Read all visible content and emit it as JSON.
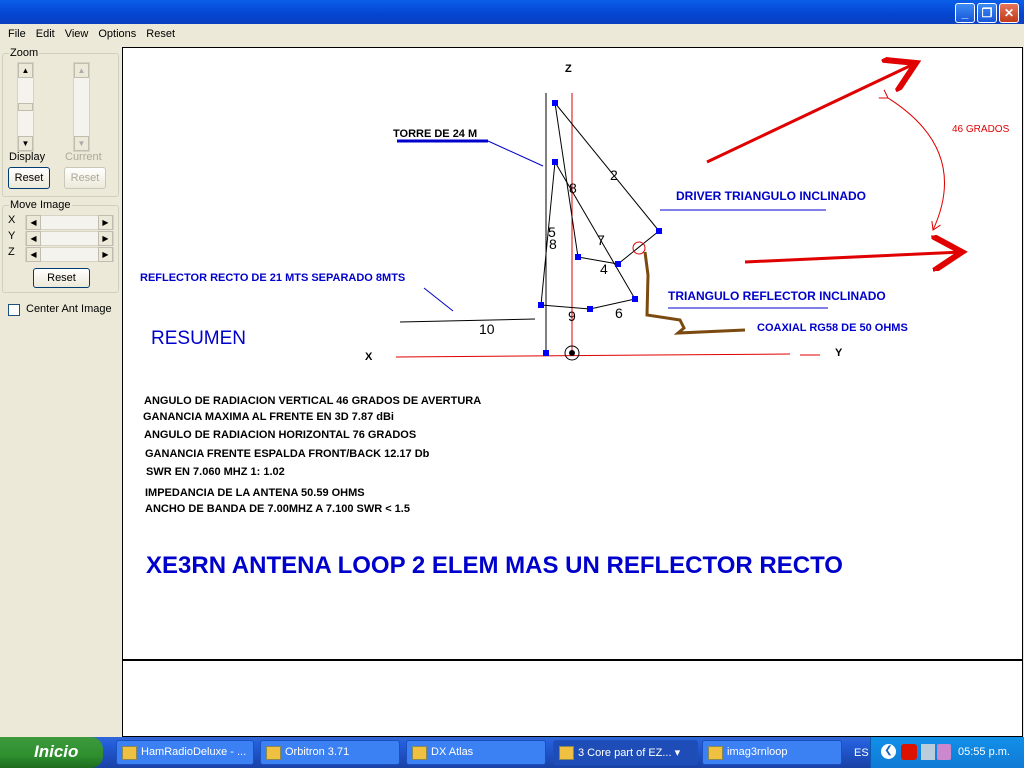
{
  "window": {
    "title": "",
    "controls": [
      "minimize",
      "maximize",
      "close"
    ]
  },
  "menu": [
    "File",
    "Edit",
    "View",
    "Options",
    "Reset"
  ],
  "sidebar": {
    "zoom": {
      "label": "Zoom",
      "display_label": "Display",
      "current_label": "Current",
      "reset": "Reset",
      "reset_disabled": "Reset"
    },
    "move": {
      "label": "Move Image",
      "axes": [
        "X",
        "Y",
        "Z"
      ],
      "reset": "Reset"
    },
    "center_checkbox": {
      "label": "Center Ant Image",
      "checked": false
    }
  },
  "diagram": {
    "axis_z": "Z",
    "axis_x": "X",
    "axis_y": "Y",
    "wire_labels": [
      "2",
      "8",
      "5",
      "8",
      "7",
      "4",
      "9",
      "6",
      "10"
    ],
    "torre": "TORRE DE 24 M",
    "driver": "DRIVER TRIANGULO INCLINADO",
    "reflector_tri": "TRIANGULO REFLECTOR  INCLINADO",
    "reflector_recto": "REFLECTOR RECTO DE 21 MTS SEPARADO 8MTS",
    "coax": "COAXIAL RG58  DE 50 OHMS",
    "grados": "46 GRADOS",
    "resumen": "RESUMEN",
    "summary": [
      "ANGULO DE RADIACION VERTICAL 46 GRADOS DE AVERTURA",
      "GANANCIA MAXIMA AL FRENTE EN 3D   7.87 dBi",
      "ANGULO DE RADIACION HORIZONTAL 76 GRADOS",
      "GANANCIA FRENTE ESPALDA FRONT/BACK 12.17 Db",
      "SWR   EN 7.060 MHZ  1: 1.02",
      "IMPEDANCIA DE LA ANTENA  50.59 OHMS",
      "ANCHO DE BANDA DE 7.00MHZ A 7.100   SWR < 1.5"
    ],
    "headline": "XE3RN ANTENA LOOP  2 ELEM MAS UN REFLECTOR RECTO",
    "colors": {
      "wire": "#000000",
      "node": "#0000ff",
      "axis": "#e00000",
      "coax": "#7a4a10",
      "label": "#0000cc"
    }
  },
  "taskbar": {
    "start": "Inicio",
    "tasks": [
      "HamRadioDeluxe - ...",
      "Orbitron 3.71",
      "DX Atlas",
      "3 Core part of EZ...",
      "imag3rnloop"
    ],
    "lang": "ES",
    "clock": "05:55 p.m."
  }
}
